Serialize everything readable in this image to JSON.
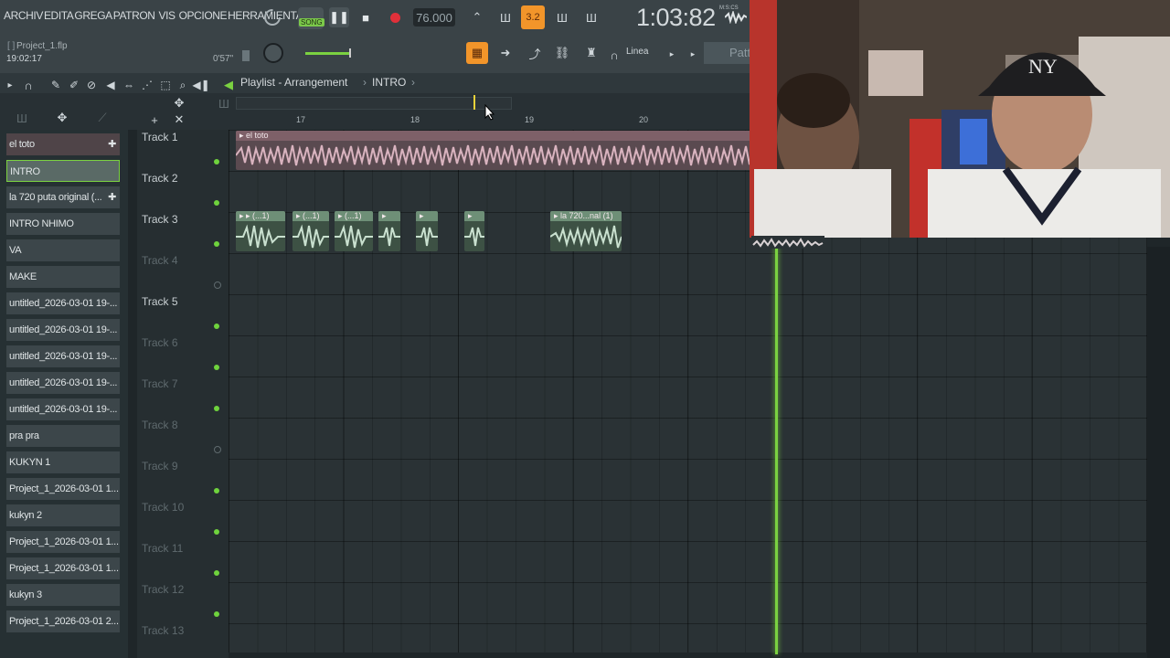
{
  "menu": [
    "ARCHIV",
    "EDITA",
    "GREGA",
    "PATRON",
    "VIS",
    "OPCIONE",
    "HERRAMIENTA"
  ],
  "transport": {
    "song_label": "SONG",
    "tempo": "76.000",
    "snap": "3.2",
    "time": "1:03:82",
    "time_format": "M:S:CS"
  },
  "project": {
    "filename": "Project_1.flp",
    "time": "19:02:17",
    "position": "0'57\""
  },
  "toolbar": {
    "snap_mode": "Linea",
    "pattern_label": "Patt"
  },
  "playlist": {
    "title": "Playlist - Arrangement",
    "arrangement": "INTRO",
    "ruler": [
      "17",
      "18",
      "19",
      "20"
    ]
  },
  "browser": {
    "items": [
      "el toto",
      "INTRO",
      "la 720 puta original (...",
      "INTRO NHIMO",
      "VA",
      "MAKE",
      "untitled_2026-03-01 19-...",
      "untitled_2026-03-01 19-...",
      "untitled_2026-03-01 19-...",
      "untitled_2026-03-01 19-...",
      "untitled_2026-03-01 19-...",
      "pra pra",
      "KUKYN 1",
      "Project_1_2026-03-01 1...",
      "kukyn 2",
      "Project_1_2026-03-01 1...",
      "Project_1_2026-03-01 1...",
      "kukyn 3",
      "Project_1_2026-03-01 2..."
    ]
  },
  "tracks": [
    "Track 1",
    "Track 2",
    "Track 3",
    "Track 4",
    "Track 5",
    "Track 6",
    "Track 7",
    "Track 8",
    "Track 9",
    "Track 10",
    "Track 11",
    "Track 12",
    "Track 13"
  ],
  "clips": {
    "track1": "el toto",
    "track3_short": "(...1)",
    "track3_long": "la 720...nal (1)"
  },
  "colors": {
    "accent_green": "#7bd241",
    "accent_orange": "#f2952a",
    "record_red": "#e0303a",
    "clip_pink": "#c48f9e",
    "clip_green": "#6e8f77"
  }
}
